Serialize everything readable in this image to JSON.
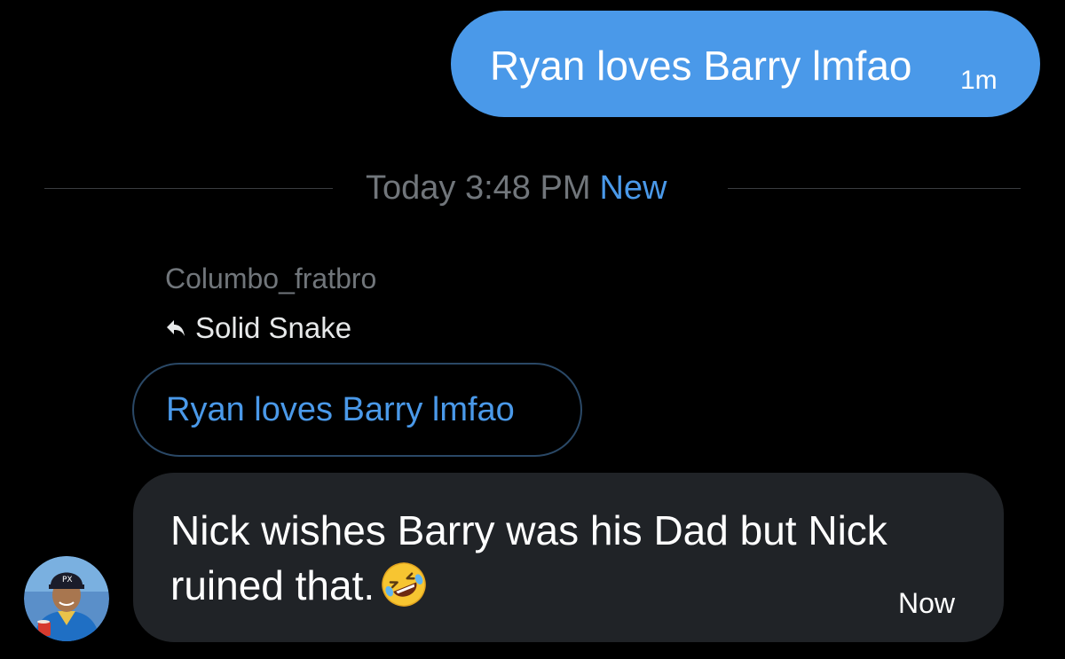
{
  "outgoing_message": {
    "text": "Ryan loves Barry lmfao",
    "time": "1m"
  },
  "divider": {
    "time": "Today 3:48 PM",
    "new_label": "New"
  },
  "incoming_group": {
    "sender_name": "Columbo_fratbro",
    "reply_to_name": "Solid Snake",
    "quoted_message": "Ryan loves Barry lmfao",
    "message": {
      "text_line_1": "Nick wishes Barry was his Dad but Nick",
      "text_line_2": "ruined that.",
      "emoji": "rolling-on-the-floor-laughing-emoji",
      "time": "Now"
    },
    "avatar": "user-avatar-photo"
  },
  "colors": {
    "background": "#000000",
    "outgoing_bubble": "#4a99e9",
    "incoming_bubble": "#202327",
    "accent": "#4a99e9",
    "muted_text": "#71767b",
    "divider_line": "#3a3d40"
  },
  "icons": {
    "reply": "reply-arrow-icon"
  }
}
